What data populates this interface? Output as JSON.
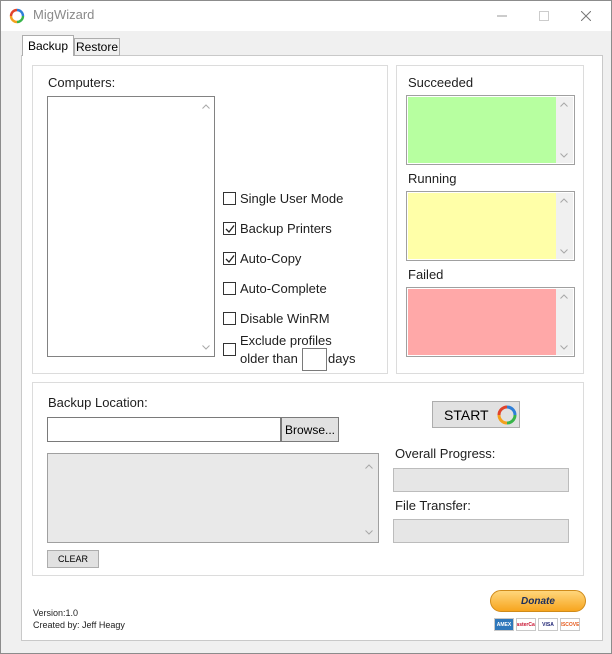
{
  "window": {
    "title": "MigWizard"
  },
  "tabs": [
    {
      "label": "Backup",
      "selected": true
    },
    {
      "label": "Restore",
      "selected": false
    }
  ],
  "computers": {
    "label": "Computers:"
  },
  "options": [
    {
      "label": "Single User Mode",
      "checked": false
    },
    {
      "label": "Backup Printers",
      "checked": true
    },
    {
      "label": "Auto-Copy",
      "checked": true
    },
    {
      "label": "Auto-Complete",
      "checked": false
    },
    {
      "label": "Disable WinRM",
      "checked": false
    }
  ],
  "exclude_profiles": {
    "line1": "Exclude profiles",
    "line2_prefix": "older than",
    "line2_suffix": "days",
    "checked": false,
    "days_value": ""
  },
  "status": {
    "succeeded": {
      "label": "Succeeded",
      "color": "#b7ffa0"
    },
    "running": {
      "label": "Running",
      "color": "#ffffa8"
    },
    "failed": {
      "label": "Failed",
      "color": "#ffa8a8"
    }
  },
  "backup": {
    "location_label": "Backup Location:",
    "location_value": "",
    "browse_label": "Browse...",
    "start_label": "START",
    "clear_label": "CLEAR",
    "overall_progress_label": "Overall Progress:",
    "file_transfer_label": "File Transfer:",
    "overall_progress": 0,
    "file_transfer_progress": 0
  },
  "footer": {
    "version": "Version:1.0",
    "created_by": "Created by: Jeff Heagy",
    "donate_label": "Donate",
    "cards": [
      "AMEX",
      "MasterCard",
      "VISA",
      "DISCOVER"
    ]
  }
}
